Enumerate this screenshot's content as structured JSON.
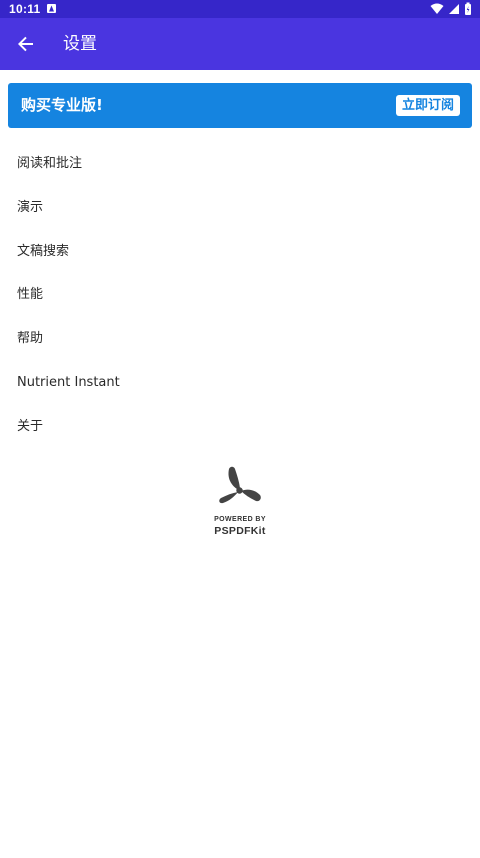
{
  "status_bar": {
    "time": "10:11",
    "notification_icon": "android-notification-icon",
    "wifi_icon": "wifi-icon",
    "signal_icon": "cell-signal-icon",
    "battery_icon": "battery-icon"
  },
  "app_bar": {
    "title": "设置",
    "back_icon": "arrow-back-icon",
    "color": "#4a35e0"
  },
  "promo": {
    "title": "购买专业版!",
    "button_label": "立即订阅",
    "color": "#1584e0"
  },
  "settings": {
    "items": [
      {
        "label": "阅读和批注"
      },
      {
        "label": "演示"
      },
      {
        "label": "文稿搜索"
      },
      {
        "label": "性能"
      },
      {
        "label": "帮助"
      },
      {
        "label": "Nutrient Instant"
      },
      {
        "label": "关于"
      }
    ]
  },
  "footer": {
    "logo_icon": "pspdfkit-logo-icon",
    "powered_label": "POWERED BY",
    "brand": "PSPDFKit"
  }
}
